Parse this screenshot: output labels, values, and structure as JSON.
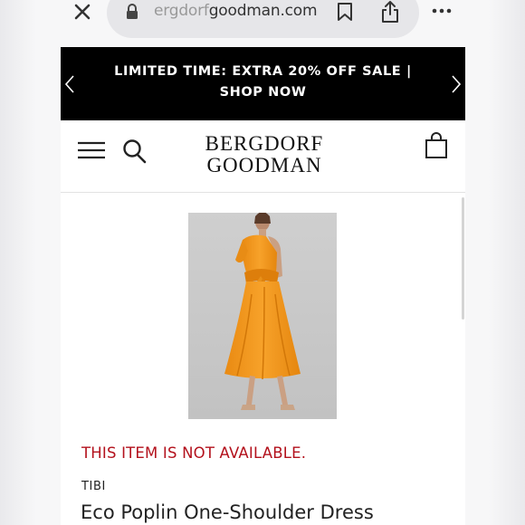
{
  "browser": {
    "url_faded": "ergdorf",
    "url_main": "goodman.com",
    "icons": {
      "close": "close-icon",
      "lock": "lock-icon",
      "bookmark": "bookmark-icon",
      "share": "share-icon",
      "more": "more-icon"
    }
  },
  "promo": {
    "text": "LIMITED TIME: EXTRA 20% OFF SALE | SHOP NOW"
  },
  "header": {
    "logo_line1": "BERGDORF",
    "logo_line2": "GOODMAN",
    "icons": {
      "menu": "hamburger-menu-icon",
      "search": "search-icon",
      "bag": "shopping-bag-icon"
    }
  },
  "product": {
    "availability": "THIS ITEM IS NOT AVAILABLE.",
    "brand": "TIBI",
    "name": "Eco Poplin One-Shoulder Dress",
    "image_description": "orange one-shoulder dress"
  },
  "colors": {
    "promo_bg": "#000000",
    "alert_red": "#b3111c",
    "dress_orange": "#f2981e"
  }
}
